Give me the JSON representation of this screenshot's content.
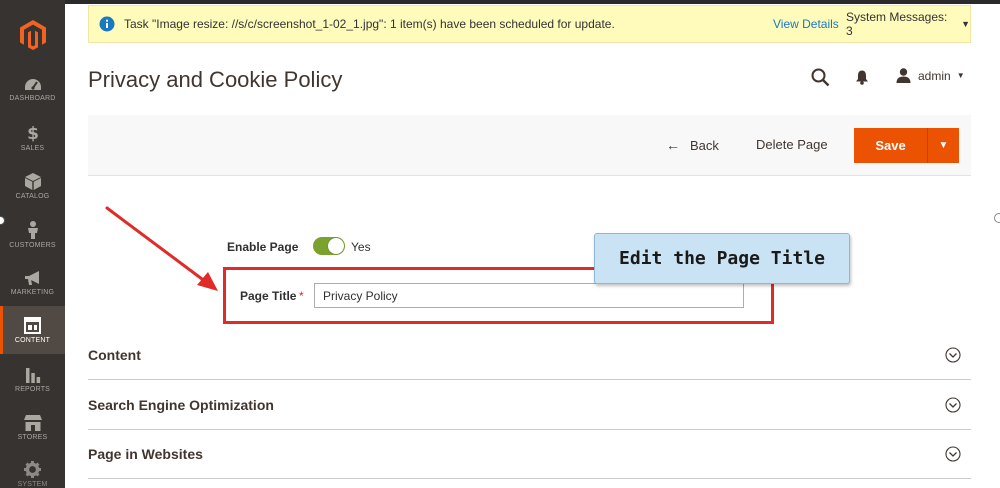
{
  "notification": {
    "message": "Task \"Image resize: //s/c/screenshot_1-02_1.jpg\": 1 item(s) have been scheduled for update.",
    "view_details": "View Details",
    "system_messages": "System Messages: 3"
  },
  "sidebar": {
    "items": [
      {
        "label": "DASHBOARD",
        "icon": "dashboard-icon"
      },
      {
        "label": "SALES",
        "icon": "dollar-icon"
      },
      {
        "label": "CATALOG",
        "icon": "cube-icon"
      },
      {
        "label": "CUSTOMERS",
        "icon": "person-icon"
      },
      {
        "label": "MARKETING",
        "icon": "megaphone-icon"
      },
      {
        "label": "CONTENT",
        "icon": "layout-icon",
        "active": true
      },
      {
        "label": "REPORTS",
        "icon": "bar-chart-icon"
      },
      {
        "label": "STORES",
        "icon": "store-icon"
      },
      {
        "label": "SYSTEM",
        "icon": "gear-icon"
      }
    ]
  },
  "header": {
    "title": "Privacy and Cookie Policy",
    "user": "admin"
  },
  "actions": {
    "back": "Back",
    "delete": "Delete Page",
    "save": "Save"
  },
  "form": {
    "enable_label": "Enable Page",
    "enable_value": "Yes",
    "title_label": "Page Title",
    "required_mark": "*",
    "title_value": "Privacy Policy"
  },
  "callout": {
    "text": "Edit the Page Title"
  },
  "sections": [
    {
      "title": "Content"
    },
    {
      "title": "Search Engine Optimization"
    },
    {
      "title": "Page in Websites"
    }
  ],
  "colors": {
    "accent": "#eb5202",
    "toggle_on": "#79a22e",
    "highlight": "#e02b27",
    "callout_bg": "#c9e3f5"
  }
}
